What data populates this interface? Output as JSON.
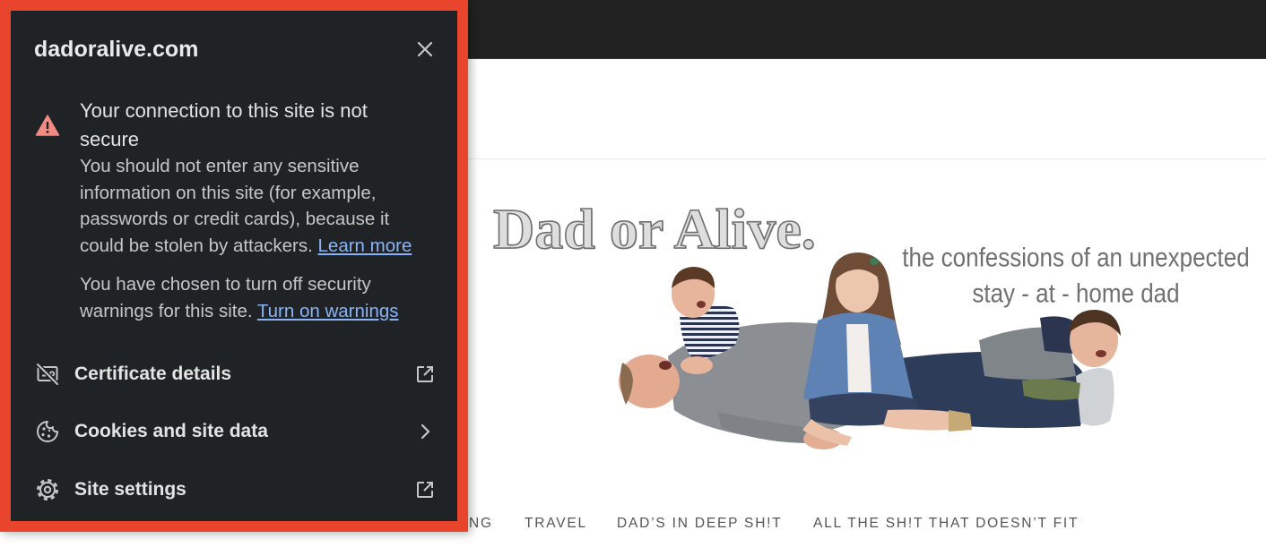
{
  "site": {
    "logo_title": "Dad or Alive.",
    "tagline_line1": "the confessions of an unexpected",
    "tagline_line2": "stay - at - home dad",
    "nav": [
      {
        "label": "NG"
      },
      {
        "label": "TRAVEL"
      },
      {
        "label": "DAD’S IN DEEP SH!T"
      },
      {
        "label": "ALL THE SH!T THAT DOESN’T FIT"
      }
    ]
  },
  "popup": {
    "domain": "dadoralive.com",
    "close_icon": "close-icon",
    "warning": {
      "icon": "warning-triangle-icon",
      "heading": "Your connection to this site is not secure",
      "description": "You should not enter any sensitive information on this site (for example, passwords or credit cards), because it could be stolen by attackers.",
      "learn_more": "Learn more",
      "warnings_off_text": "You have chosen to turn off security warnings for this site.",
      "turn_on_warnings": "Turn on warnings"
    },
    "rows": [
      {
        "label": "Certificate details",
        "icon": "certificate-off-icon",
        "trailing_icon": "external-link-icon"
      },
      {
        "label": "Cookies and site data",
        "icon": "cookie-icon",
        "trailing_icon": "chevron-right-icon"
      },
      {
        "label": "Site settings",
        "icon": "gear-icon",
        "trailing_icon": "external-link-icon"
      }
    ]
  },
  "colors": {
    "highlight_frame": "#e8452c",
    "popup_background": "#1f2326",
    "warning_icon": "#f28b82",
    "link": "#8ab4f8",
    "nav_text": "#555555",
    "browser_top_bar": "#212121"
  }
}
